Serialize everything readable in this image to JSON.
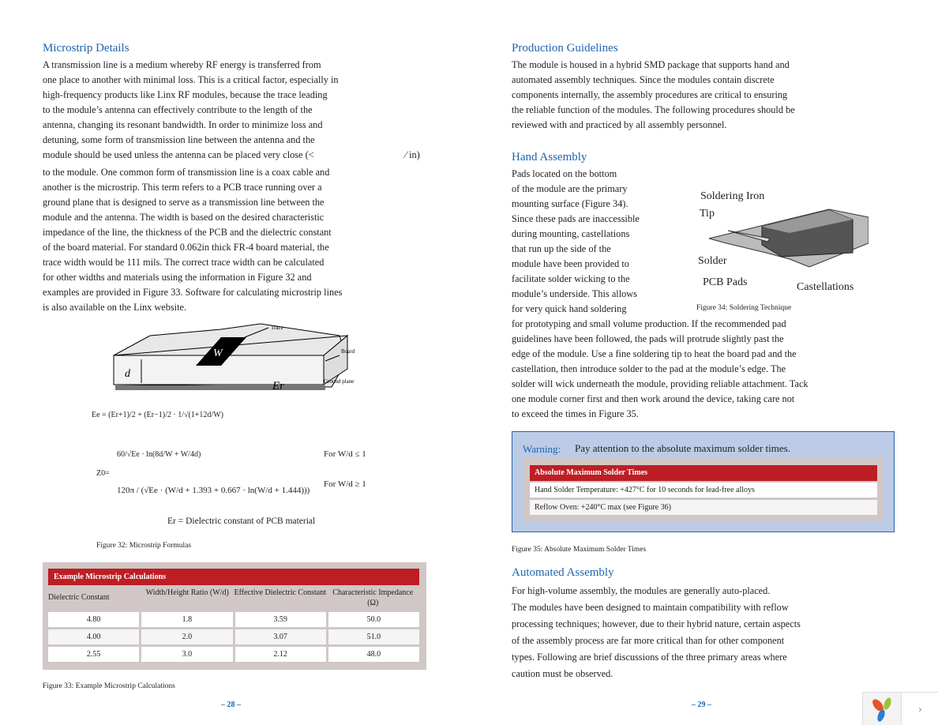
{
  "left": {
    "heading": "Microstrip Details",
    "para1": [
      "A transmission line is a medium whereby RF energy is transferred from",
      "one place to another with minimal loss. This is a critical factor, especially in",
      "high-frequency products like Linx RF modules, because the trace leading",
      "to the module’s antenna can effectively contribute to the length of the",
      "antenna, changing its resonant bandwidth. In order to minimize loss and",
      "detuning, some form of transmission line between the antenna and the",
      "module should be used unless the antenna can be placed very close (<"
    ],
    "para1_tail": "⁄ in)",
    "para2": [
      "to the module. One common form of transmission line is a coax cable and",
      "another is the microstrip. This term refers to a PCB trace running over a",
      "ground plane that is designed to serve as a transmission line between the",
      "module and the antenna. The width is based on the desired characteristic",
      "impedance of the line, the thickness of the PCB and the dielectric constant",
      "of the board material. For standard 0.062in thick FR-4 board material, the",
      "trace width would be 111 mils. The correct trace width can be calculated",
      "for other widths and materials using the information in Figure 32 and",
      "examples are provided in Figure 33. Software for calculating microstrip lines",
      "is also available on the Linx website."
    ],
    "figure32": {
      "labels": {
        "trace": "Trace",
        "board": "Board",
        "ground": "Ground plane",
        "w": "W",
        "d": "d",
        "er": "Er"
      },
      "eq1": "Ee = (Er+1)/2 + (Er−1)/2 · 1/√(1+12d/W)",
      "eq2a": "60/√Ee · ln(8d/W + W/4d)",
      "eq2a_cond": "For  W/d ≤ 1",
      "eq2b": "120π / (√Ee · (W/d + 1.393 + 0.667 · ln(W/d + 1.444)))",
      "eq2b_cond": "For  W/d ≥ 1",
      "z0": "Z0=",
      "er_def": "Er = Dielectric constant of PCB material",
      "caption": "Figure 32: Microstrip Formulas"
    },
    "table": {
      "title": "Example Microstrip Calculations",
      "headers": [
        "Dielectric Constant",
        "Width/Height Ratio (W/d)",
        "Effective Dielectric Constant",
        "Characteristic Impedance (Ω)"
      ],
      "rows": [
        [
          "4.80",
          "1.8",
          "3.59",
          "50.0"
        ],
        [
          "4.00",
          "2.0",
          "3.07",
          "51.0"
        ],
        [
          "2.55",
          "3.0",
          "2.12",
          "48.0"
        ]
      ],
      "caption": "Figure 33: Example Microstrip Calculations"
    },
    "page_number": "– 28 –"
  },
  "right": {
    "heading1": "Production Guidelines",
    "para1": [
      "The module is housed in a hybrid SMD package that supports hand and",
      "automated assembly techniques. Since the modules contain discrete",
      "components internally, the assembly procedures are critical to ensuring",
      "the reliable function of the modules. The following procedures should be",
      "reviewed with and practiced by all assembly personnel."
    ],
    "heading2": "Hand Assembly",
    "para2a": [
      "Pads located on the bottom",
      "of the module are the primary",
      "mounting surface (Figure 34).",
      "Since these pads are inaccessible",
      "during mounting, castellations",
      "that run up the side of the",
      "module have been provided to",
      "facilitate solder wicking to the",
      "module’s underside. This allows",
      "for very quick hand soldering"
    ],
    "para2b": [
      "for prototyping and small volume production.  If the recommended pad",
      "guidelines have been followed, the pads will protrude slightly past the",
      "edge of the module. Use a fine soldering tip to heat the board pad and the",
      "castellation, then introduce solder to the pad at the module’s edge. The",
      "solder will wick underneath the module, providing reliable attachment. Tack",
      "one module corner first and then work around the device, taking care not",
      "to exceed the times in Figure 35."
    ],
    "figure34": {
      "iron": "Soldering Iron",
      "tip": "Tip",
      "solder": "Solder",
      "pads": "PCB Pads",
      "castellations": "Castellations",
      "caption": "Figure 34: Soldering Technique"
    },
    "warning": {
      "label": "Warning:",
      "message": "Pay attention to the absolute maximum solder times.",
      "table_title": "Absolute Maximum Solder Times",
      "rows": [
        "Hand Solder Temperature: +427°C for 10 seconds for lead-free alloys",
        "Reflow Oven: +240°C max (see Figure 36)"
      ],
      "caption": "Figure 35: Absolute Maximum Solder Times"
    },
    "heading3": "Automated Assembly",
    "para3": [
      "For high-volume assembly, the modules are generally auto-placed.",
      "The modules have been designed to maintain compatibility with reflow",
      "processing techniques; however, due to their hybrid nature, certain aspects",
      "of the assembly process are far more critical than for other component",
      "types. Following are brief discussions of the three primary areas where",
      "caution must be observed."
    ],
    "page_number": "– 29 –"
  },
  "nav": {
    "next_icon": "chevron-right",
    "logo_icon": "app-logo"
  },
  "colors": {
    "heading": "#1f63ae",
    "table_header": "#bd1e24",
    "table_frame": "#d0c7c6",
    "warning_bg": "#bccbe6"
  }
}
